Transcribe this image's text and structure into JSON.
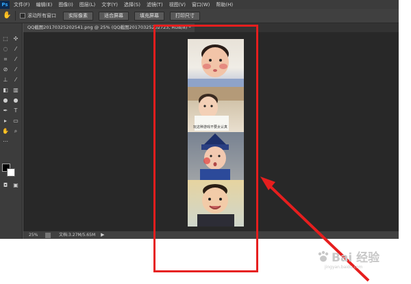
{
  "menubar": {
    "logo": "Ps",
    "items": [
      "文件(F)",
      "编辑(E)",
      "图像(I)",
      "图层(L)",
      "文字(Y)",
      "选择(S)",
      "滤镜(T)",
      "视图(V)",
      "窗口(W)",
      "帮助(H)"
    ]
  },
  "options_bar": {
    "scroll_all_label": "滚动所有窗口",
    "buttons": [
      "实际像素",
      "适合屏幕",
      "填充屏幕",
      "打印尺寸"
    ]
  },
  "document_tab": {
    "title": "QQ截图20170325202541.png @ 25% (QQ截图20170325202723, RGB/8) *"
  },
  "document": {
    "photo_caption": "玩这种游戏不要太认真"
  },
  "statusbar": {
    "zoom": "25%",
    "doc_info": "文档:3.27M/5.65M",
    "arrow": "▶"
  },
  "watermark": {
    "brand": "Bai 经验",
    "sub": "jingyan.baidu.com"
  },
  "colors": {
    "highlight": "#e61e1e",
    "canvas": "#282828",
    "foreground_swatch": "#000000",
    "background_swatch": "#ffffff"
  }
}
